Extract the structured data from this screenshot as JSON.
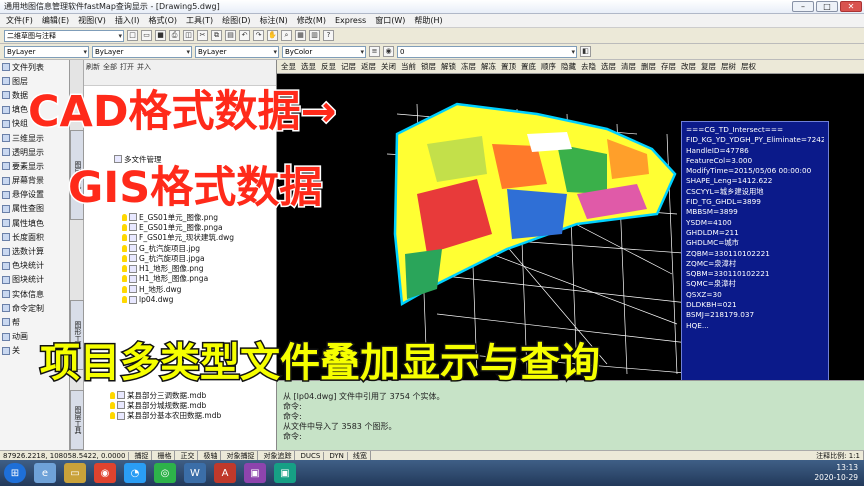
{
  "window": {
    "title": "通用地图信息管理软件fastMap查询显示 - [Drawing5.dwg]"
  },
  "menu": [
    "文件(F)",
    "编辑(E)",
    "视图(V)",
    "插入(I)",
    "格式(O)",
    "工具(T)",
    "绘图(D)",
    "标注(N)",
    "修改(M)",
    "Express",
    "窗口(W)",
    "帮助(H)"
  ],
  "toolbar": {
    "workspace": "二维草图与注释",
    "layer_value": "0",
    "color": "ByLayer",
    "linetype": "ByLayer",
    "lineweight": "ByLayer",
    "plotstyle": "ByColor"
  },
  "left_tools": [
    "文件列表",
    "图层",
    "数据",
    "填色",
    "快组",
    "三维显示",
    "透明显示",
    "要素显示",
    "屏幕背景",
    "悬停设置",
    "属性查图",
    "属性填色",
    "长度面积",
    "选数计算",
    "色块统计",
    "图块统计",
    "实体信息",
    "命令定制",
    "帮",
    "动画",
    "关"
  ],
  "vtabs": [
    "图层工具",
    "图形工具",
    "图层工具"
  ],
  "file_panel": {
    "tools": [
      "刷新",
      "全部",
      "打开",
      "并入"
    ],
    "root": "多文件管理",
    "files": [
      "E_GS01单元_图像.png",
      "E_GS01单元_图像.pngа",
      "F_GS01单元_现状建筑.dwg",
      "G_杭汽旋项目.jpg",
      "G_杭汽旋项目.jpga",
      "H1_地形_图像.png",
      "H1_地形_图像.pnga",
      "H_地形.dwg",
      "lp04.dwg"
    ],
    "bottom_files": [
      "某县部分三调数据.mdb",
      "某县部分城规数据.mdb",
      "某县部分基本农田数据.mdb"
    ]
  },
  "cad_tools": [
    "全显",
    "选显",
    "反显",
    "记层",
    "返层",
    "关闭",
    "当前",
    "锁层",
    "解锁",
    "冻层",
    "解冻",
    "置顶",
    "置底",
    "顺序",
    "隐藏",
    "隐藏",
    "去隐",
    "选层",
    "选层",
    "清层",
    "删层",
    "存层",
    "改层",
    "复层",
    "层树",
    "层权"
  ],
  "props": [
    "===CG_TD_Intersect===",
    "FID_KG_YD_YDGH_PY_Eliminate=7242",
    "HandleID=47786",
    "FeatureCol=3.000",
    "ModifyTime=2015/05/06 00:00:00",
    "SHAPE_Leng=1412.622",
    "CSCYYL=城乡建设用地",
    "FID_TG_GHDL=3899",
    "MBBSM=3899",
    "YSDM=4100",
    "GHDLDM=211",
    "GHDLMC=城市",
    "ZQBM=330110102221",
    "ZQMC=泉漳村",
    "SQBM=330110102221",
    "SQMC=泉漳村",
    "QSXZ=30",
    "DLDKBH=021",
    "BSMJ=218179.037",
    "HQE..."
  ],
  "command": [
    "从 [lp04.dwg] 文件中引用了 3754 个实体。",
    "命令:",
    "命令:",
    "从文件中导入了 3583 个图形。",
    "命令:"
  ],
  "status": {
    "coords": "87926.2218, 108058.5422, 0.0000",
    "modes": [
      "捕捉",
      "栅格",
      "正交",
      "极轴",
      "对象捕捉",
      "对象追踪",
      "DUCS",
      "DYN",
      "线宽"
    ],
    "annotation_scale": "注释比例: 1:1"
  },
  "clock": {
    "time": "13:13",
    "date": "2020-10-29"
  },
  "overlay": {
    "line1": "CAD格式数据→",
    "line2": "GIS格式数据",
    "line3": "项目多类型文件叠加显示与查询"
  },
  "colors": {
    "overlay_red": "#ff2a1a",
    "overlay_yellow": "#f6ff00",
    "props_bg": "#0b1a8a"
  }
}
